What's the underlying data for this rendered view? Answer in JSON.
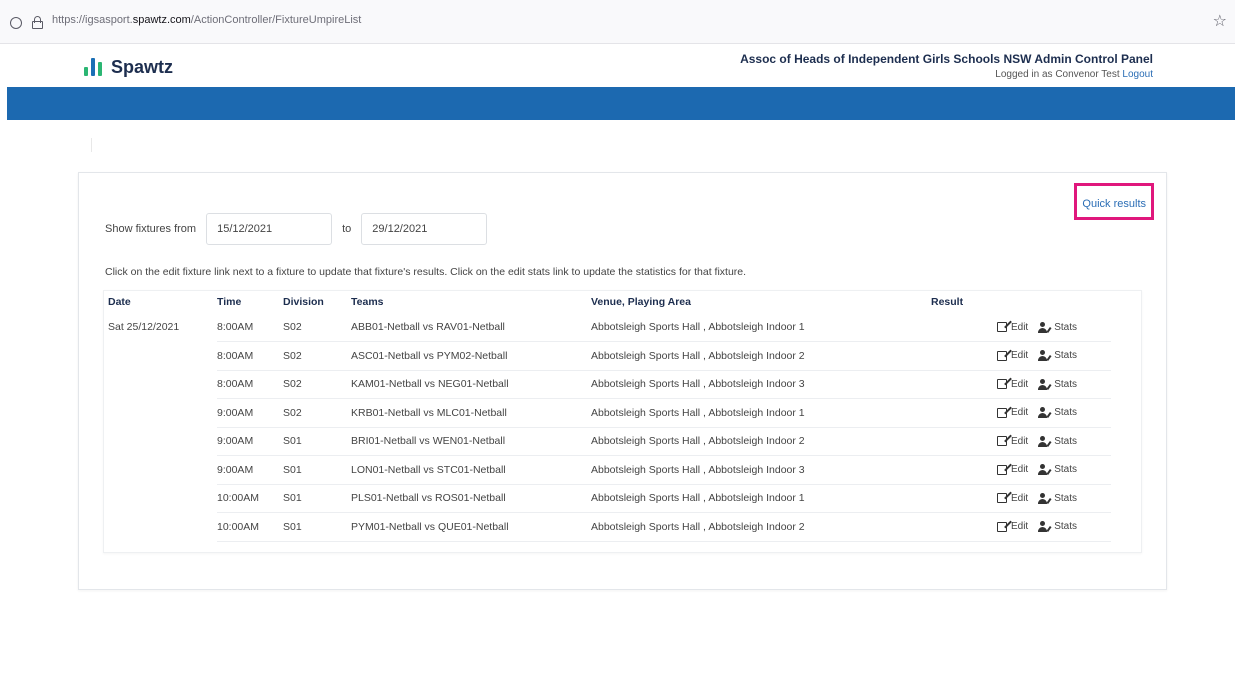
{
  "browser": {
    "url_prefix": "https://igsasport.",
    "url_domain": "spawtz.com",
    "url_path": "/ActionController/FixtureUmpireList"
  },
  "header": {
    "logo_text": "Spawtz",
    "panel_title": "Assoc of Heads of Independent Girls Schools NSW Admin Control Panel",
    "logged_in_text": "Logged in as Convenor Test",
    "logout_label": "Logout",
    "brand_color": "#1c69b0"
  },
  "toolbar": {
    "quick_results_label": "Quick results"
  },
  "filter": {
    "label": "Show fixtures from",
    "from_value": "15/12/2021",
    "to_label": "to",
    "to_value": "29/12/2021"
  },
  "instructions": "Click on the edit fixture link next to a fixture to update that fixture's results. Click on the edit stats link to update the statistics for that fixture.",
  "table": {
    "headers": {
      "date": "Date",
      "time": "Time",
      "division": "Division",
      "teams": "Teams",
      "venue": "Venue, Playing Area",
      "result": "Result"
    },
    "edit_label": "Edit",
    "stats_label": "Stats",
    "date_value": "Sat 25/12/2021",
    "rows": [
      {
        "time": "8:00AM",
        "division": "S02",
        "teams": "ABB01-Netball vs RAV01-Netball",
        "venue": "Abbotsleigh Sports Hall , Abbotsleigh Indoor 1"
      },
      {
        "time": "8:00AM",
        "division": "S02",
        "teams": "ASC01-Netball vs PYM02-Netball",
        "venue": "Abbotsleigh Sports Hall , Abbotsleigh Indoor 2"
      },
      {
        "time": "8:00AM",
        "division": "S02",
        "teams": "KAM01-Netball vs NEG01-Netball",
        "venue": "Abbotsleigh Sports Hall , Abbotsleigh Indoor 3"
      },
      {
        "time": "9:00AM",
        "division": "S02",
        "teams": "KRB01-Netball vs MLC01-Netball",
        "venue": "Abbotsleigh Sports Hall , Abbotsleigh Indoor 1"
      },
      {
        "time": "9:00AM",
        "division": "S01",
        "teams": "BRI01-Netball vs WEN01-Netball",
        "venue": "Abbotsleigh Sports Hall , Abbotsleigh Indoor 2"
      },
      {
        "time": "9:00AM",
        "division": "S01",
        "teams": "LON01-Netball vs STC01-Netball",
        "venue": "Abbotsleigh Sports Hall , Abbotsleigh Indoor 3"
      },
      {
        "time": "10:00AM",
        "division": "S01",
        "teams": "PLS01-Netball vs ROS01-Netball",
        "venue": "Abbotsleigh Sports Hall , Abbotsleigh Indoor 1"
      },
      {
        "time": "10:00AM",
        "division": "S01",
        "teams": "PYM01-Netball vs QUE01-Netball",
        "venue": "Abbotsleigh Sports Hall , Abbotsleigh Indoor 2"
      }
    ]
  }
}
